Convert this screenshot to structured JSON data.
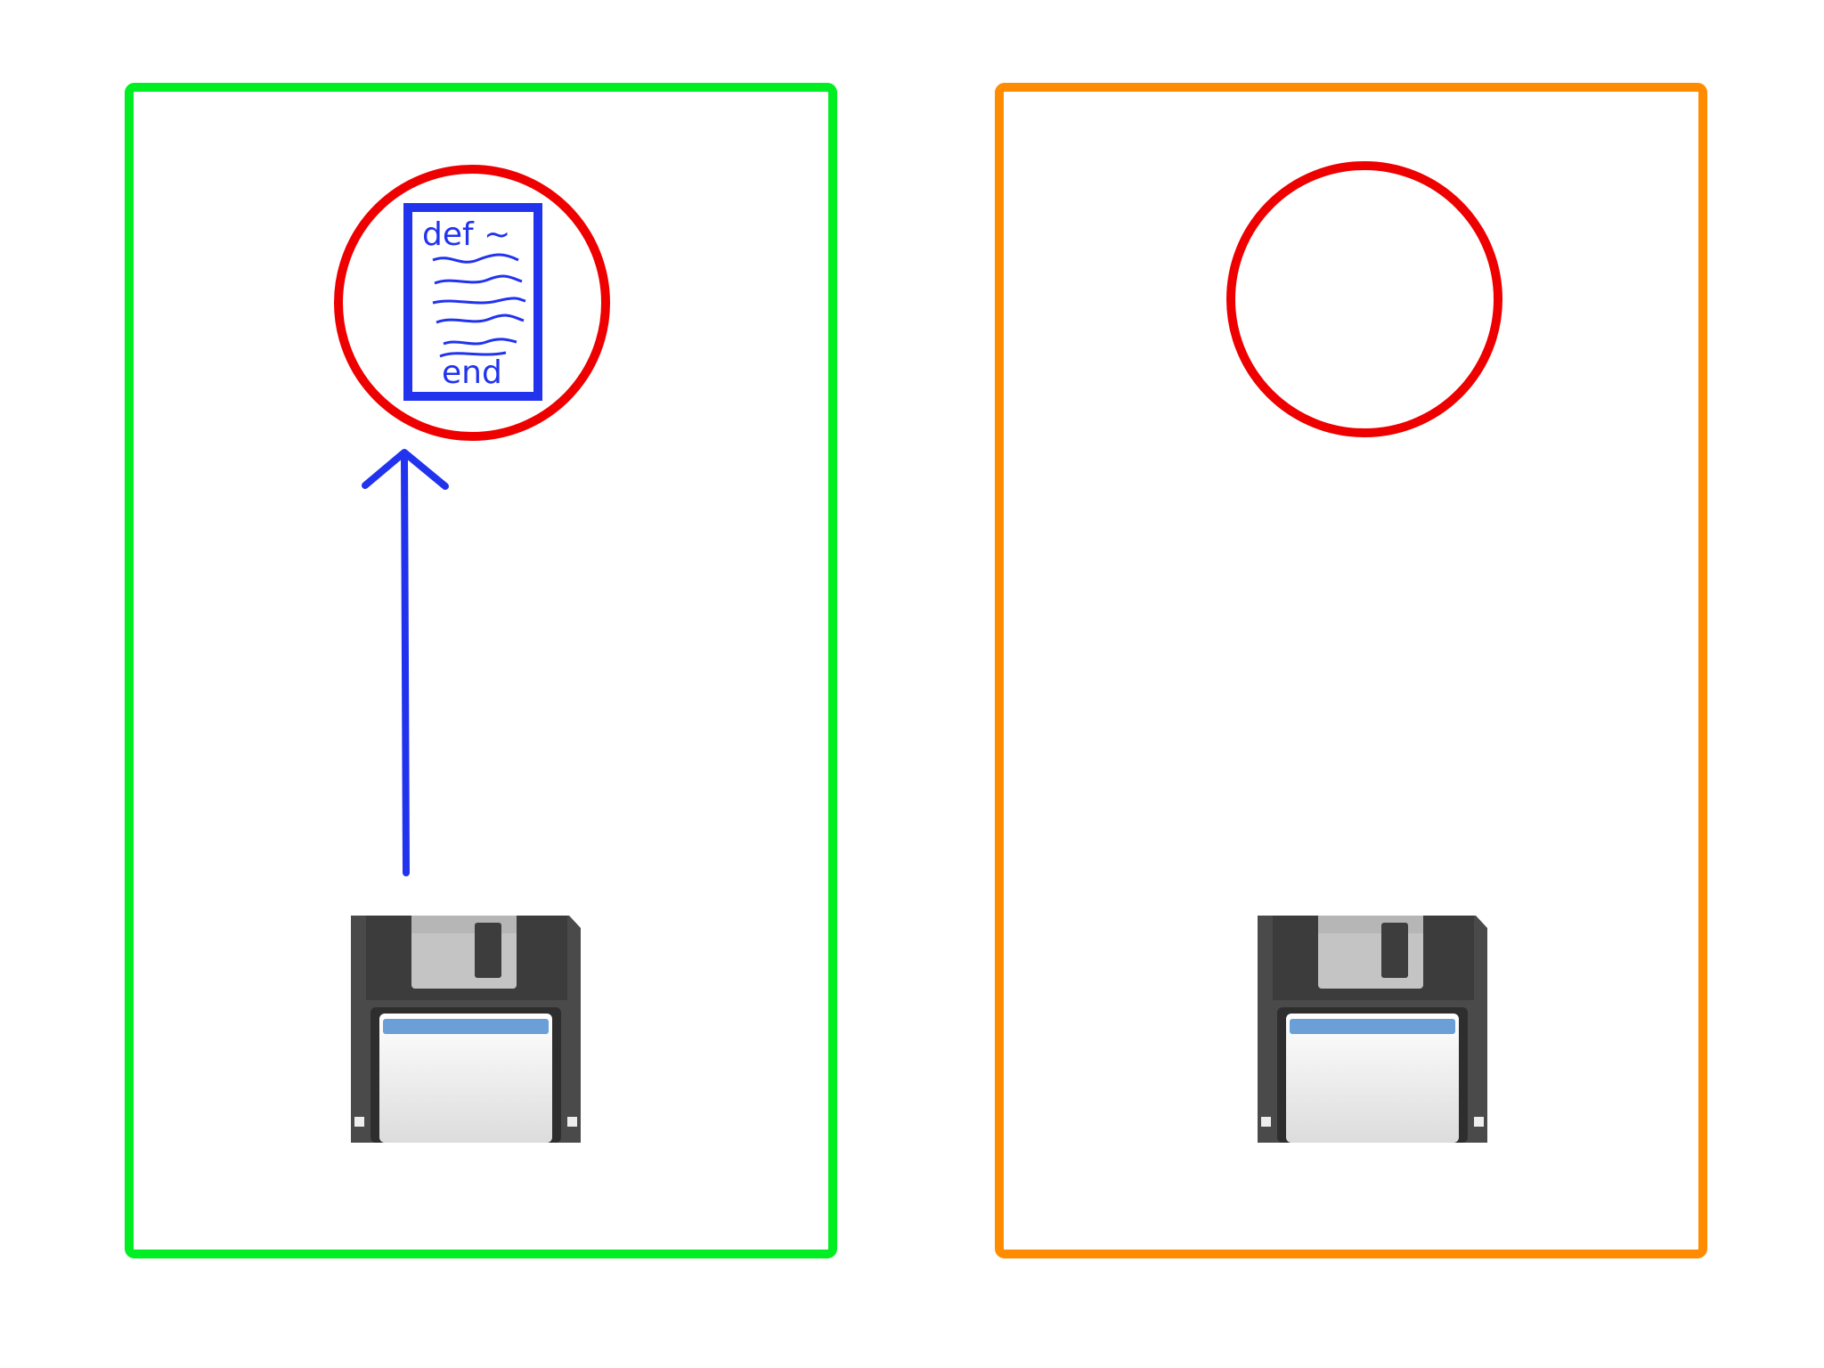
{
  "colors": {
    "background": "#ffffff",
    "left_panel_border": "#00ee22",
    "right_panel_border": "#ff8c00",
    "circle_stroke": "#ee0000",
    "script_blue": "#2233ee",
    "floppy_body": "#4a4a4a",
    "floppy_shutter": "#c0c0c0",
    "floppy_label": "#eeeeee",
    "floppy_label_stripe": "#6a9fd8"
  },
  "left_panel": {
    "script_icon": "script-document-icon",
    "script_top_text": "def ~",
    "script_bottom_text": "end",
    "arrow": "arrow-up-icon",
    "disk_icon": "floppy-disk-icon"
  },
  "right_panel": {
    "slot": "empty-circle",
    "disk_icon": "floppy-disk-icon"
  }
}
